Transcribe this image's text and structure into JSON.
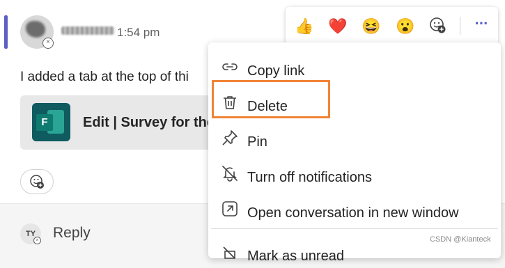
{
  "message": {
    "timestamp": "1:54 pm",
    "body_text": "I added a tab at the top of thi",
    "attachment_title": "Edit | Survey for the",
    "forms_letter": "F"
  },
  "reply": {
    "avatar_initials": "TY",
    "label": "Reply"
  },
  "reaction_bar": {
    "emojis": [
      {
        "icon": "thumbs-up-icon",
        "glyph": "👍"
      },
      {
        "icon": "heart-icon",
        "glyph": "❤️"
      },
      {
        "icon": "laughing-icon",
        "glyph": "😆"
      },
      {
        "icon": "surprised-icon",
        "glyph": "😮"
      }
    ]
  },
  "context_menu": {
    "items": [
      {
        "label": "Copy link",
        "icon": "link-icon"
      },
      {
        "label": "Delete",
        "icon": "trash-icon"
      },
      {
        "label": "Pin",
        "icon": "pin-icon"
      },
      {
        "label": "Turn off notifications",
        "icon": "bell-off-icon"
      },
      {
        "label": "Open conversation in new window",
        "icon": "open-in-window-icon"
      },
      {
        "label": "Mark as unread",
        "icon": "mark-unread-icon"
      }
    ]
  },
  "watermark": "CSDN @Kianteck",
  "colors": {
    "accent": "#5b5fc7",
    "highlight": "#f08336"
  }
}
